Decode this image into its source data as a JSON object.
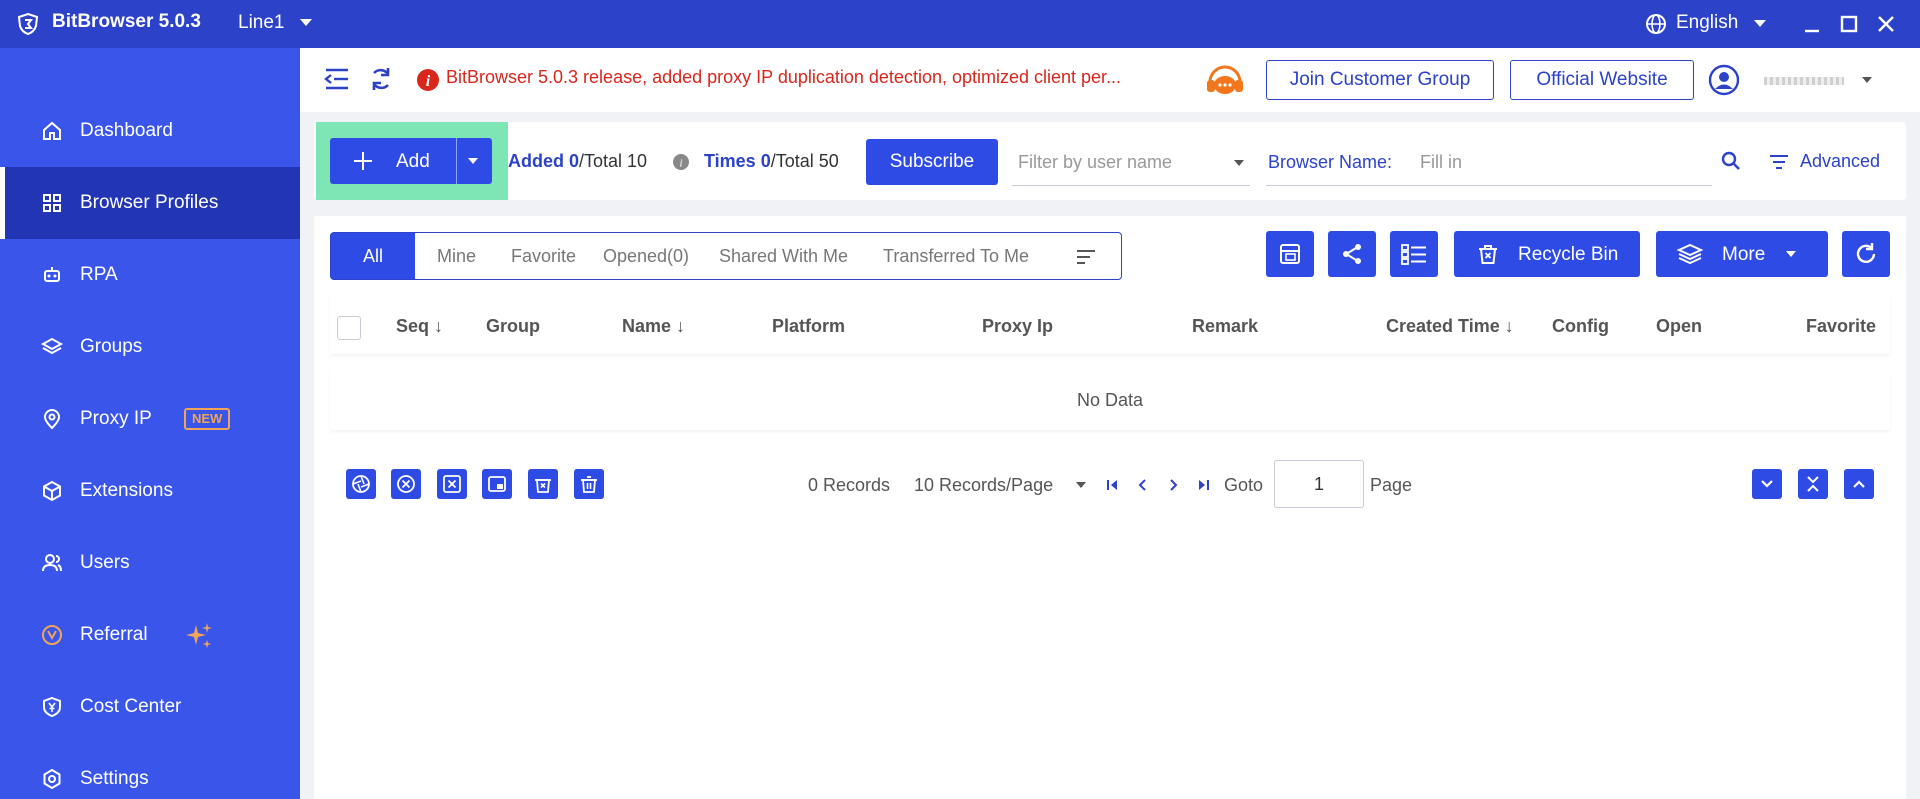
{
  "titlebar": {
    "app_title": "BitBrowser 5.0.3",
    "line": "Line1",
    "language": "English"
  },
  "sidebar": {
    "items": [
      {
        "label": "Dashboard",
        "icon": "home-icon"
      },
      {
        "label": "Browser Profiles",
        "icon": "grid-icon",
        "active": true
      },
      {
        "label": "RPA",
        "icon": "robot-icon"
      },
      {
        "label": "Groups",
        "icon": "layers-icon"
      },
      {
        "label": "Proxy IP",
        "icon": "location-pin-icon",
        "badge": "NEW"
      },
      {
        "label": "Extensions",
        "icon": "cube-icon"
      },
      {
        "label": "Users",
        "icon": "users-icon"
      },
      {
        "label": "Referral",
        "icon": "referral-icon"
      },
      {
        "label": "Cost Center",
        "icon": "shield-yen-icon"
      },
      {
        "label": "Settings",
        "icon": "settings-icon"
      }
    ]
  },
  "header": {
    "announcement": "BitBrowser 5.0.3 release, added proxy IP duplication detection, optimized client per...",
    "join_group": "Join Customer Group",
    "official_site": "Official Website"
  },
  "toolbar": {
    "add_label": "Add",
    "added_label": "Added 0",
    "added_total": "/Total 10",
    "times_label": "Times 0",
    "times_total": "/Total 50",
    "subscribe": "Subscribe",
    "filter_placeholder": "Filter by user name",
    "browser_name_label": "Browser Name:",
    "browser_name_placeholder": "Fill in",
    "advanced": "Advanced"
  },
  "tabs": {
    "all": "All",
    "mine": "Mine",
    "favorite": "Favorite",
    "opened": "Opened(0)",
    "shared": "Shared With Me",
    "transferred": "Transferred To Me"
  },
  "actions": {
    "recycle_bin": "Recycle Bin",
    "more": "More"
  },
  "table": {
    "columns": [
      "Seq",
      "Group",
      "Name",
      "Platform",
      "Proxy Ip",
      "Remark",
      "Created Time",
      "Config",
      "Open",
      "Favorite"
    ],
    "empty": "No Data"
  },
  "pagination": {
    "records": "0 Records",
    "per_page": "10 Records/Page",
    "goto": "Goto",
    "page_value": "1",
    "page": "Page"
  },
  "colors": {
    "primary": "#2f4be6",
    "titlebar": "#2c42c8",
    "sidebar": "#3a55ea",
    "sidebar_active": "#2235b5",
    "add_highlight": "#7ee6b5",
    "alert": "#d9261c",
    "badge": "#f0a45a"
  }
}
